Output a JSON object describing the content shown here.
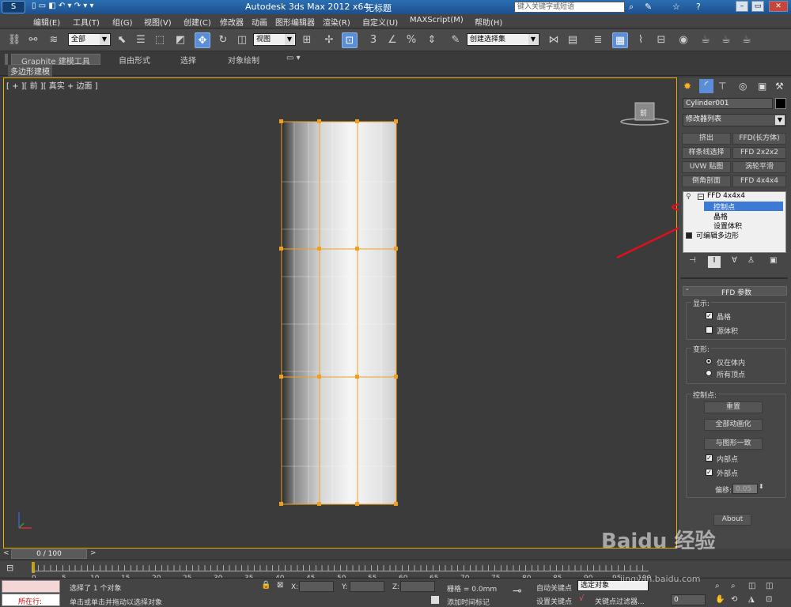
{
  "window": {
    "title": "Autodesk 3ds Max  2012 x64",
    "doc_title": "无标题",
    "search_placeholder": "键入关键字或短语"
  },
  "menu": [
    "编辑(E)",
    "工具(T)",
    "组(G)",
    "视图(V)",
    "创建(C)",
    "修改器",
    "动画",
    "图形编辑器",
    "渲染(R)",
    "自定义(U)",
    "MAXScript(M)",
    "帮助(H)"
  ],
  "toolbar": {
    "selection_filter": "全部",
    "ref_coord": "视图",
    "named_selection_placeholder": "创建选择集"
  },
  "ribbon": {
    "tabs": [
      "Graphite 建模工具",
      "自由形式",
      "选择",
      "对象绘制"
    ],
    "sub_tab": "多边形建模"
  },
  "viewport": {
    "label": "[ + ][ 前 ][ 真实 + 边面 ]",
    "viewcube_label": "前"
  },
  "command_panel": {
    "object_name": "Cylinder001",
    "modifier_list": "修改器列表",
    "modifier_buttons": [
      "挤出",
      "FFD(长方体)",
      "样条线选择",
      "FFD 2x2x2",
      "UVW 贴图",
      "涡轮平滑",
      "倒角剖面",
      "FFD 4x4x4"
    ],
    "stack": {
      "top": "FFD 4x4x4",
      "children": [
        "控制点",
        "晶格",
        "设置体积"
      ],
      "base": "可编辑多边形"
    },
    "rollout_title": "FFD 参数",
    "display_group": "显示:",
    "display_options": [
      "晶格",
      "源体积"
    ],
    "deform_group": "变形:",
    "deform_options": [
      "仅在体内",
      "所有顶点"
    ],
    "cp_group": "控制点:",
    "cp_buttons": [
      "重置",
      "全部动画化",
      "与图形一致"
    ],
    "cp_checks": [
      "内部点",
      "外部点"
    ],
    "offset_label": "偏移:",
    "offset_value": "0.05",
    "about_button": "About"
  },
  "timeline": {
    "frame_display": "0 / 100",
    "ticks": [
      "0",
      "5",
      "10",
      "15",
      "20",
      "25",
      "30",
      "35",
      "40",
      "45",
      "50",
      "55",
      "60",
      "65",
      "70",
      "75",
      "80",
      "85",
      "90",
      "95",
      "100"
    ]
  },
  "status": {
    "running_label": "所在行:",
    "selection_msg": "选择了 1 个对象",
    "prompt_msg": "单击或单击并拖动以选择对象",
    "x_label": "X:",
    "y_label": "Y:",
    "z_label": "Z:",
    "grid": "栅格 = 0.0mm",
    "add_time_tag": "添加时间标记",
    "auto_key": "自动关键点",
    "set_key": "设置关键点",
    "selected_obj": "选定对象",
    "key_filters": "关键点过滤器...",
    "frame_field": "0"
  },
  "colors": {
    "accent": "#5b8ed6",
    "selection_lattice": "#f0a020",
    "highlight_annotation": "#e0101a"
  },
  "watermark": {
    "brand": "Baidu 经验",
    "url": "jingyan.baidu.com"
  }
}
